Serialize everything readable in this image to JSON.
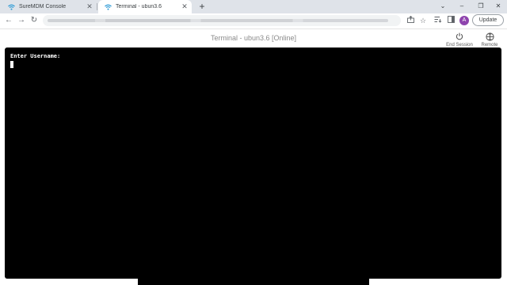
{
  "browser": {
    "tabs": [
      {
        "title": "SureMDM Console",
        "active": false
      },
      {
        "title": "Terminal - ubun3.6",
        "active": true
      }
    ],
    "new_tab_label": "+",
    "window_controls": {
      "collapse": "⌄",
      "minimize": "–",
      "restore": "❐",
      "close": "✕"
    },
    "update_label": "Update",
    "avatar_letter": "A",
    "accent_color": "#1a73e8",
    "favicon_color": "#2e9bd6"
  },
  "page": {
    "title": "Terminal - ubun3.6 [Online]",
    "actions": [
      {
        "label": "End Session",
        "icon": "power-icon"
      },
      {
        "label": "Remote",
        "icon": "remote-icon"
      }
    ]
  },
  "terminal": {
    "prompt": "Enter Username:",
    "background": "#000000",
    "text_color": "#ffffff"
  }
}
